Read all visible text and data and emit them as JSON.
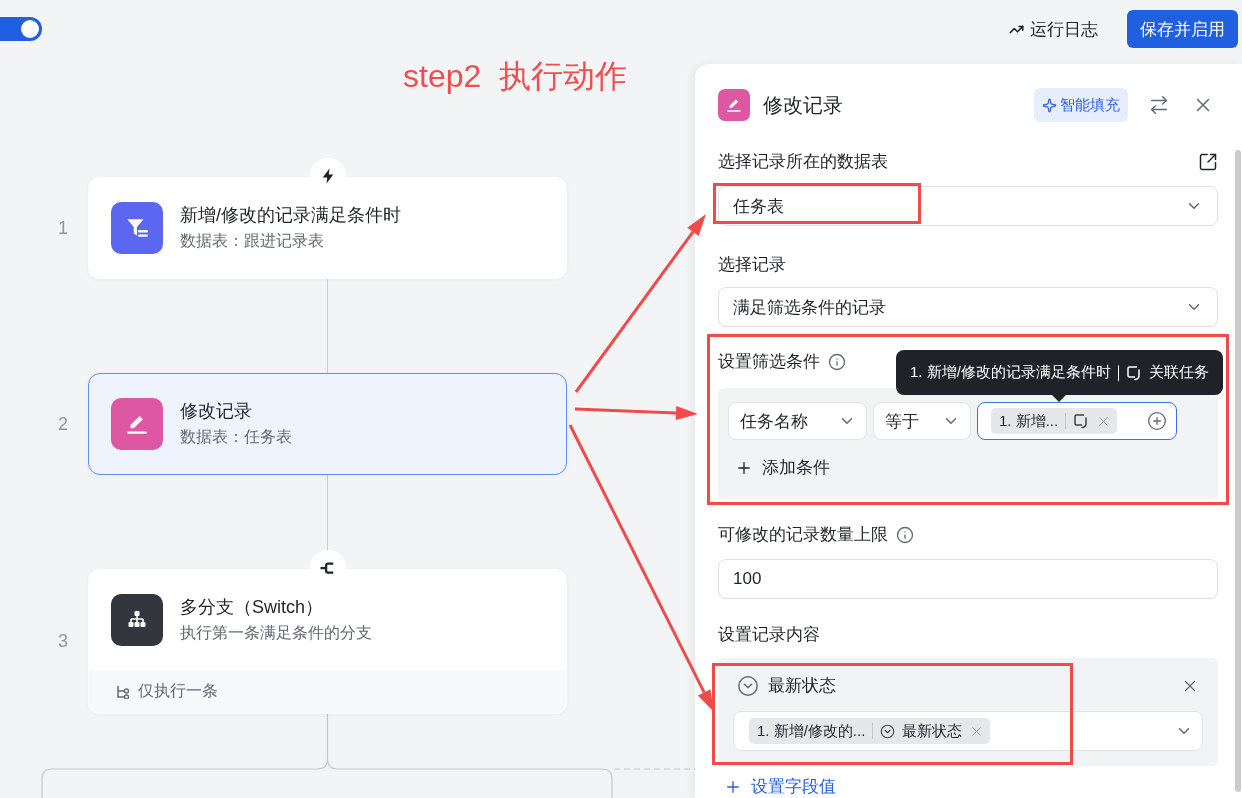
{
  "top_bar": {
    "enable_switch": {
      "on": true
    },
    "run_log": "运行日志",
    "save_button": "保存并启用"
  },
  "annotation": {
    "title": "step2  执行动作"
  },
  "flow": {
    "steps": [
      {
        "number": "1",
        "kind": "trigger",
        "title": "新增/修改的记录满足条件时",
        "subtitle": "数据表：跟进记录表",
        "selected": false
      },
      {
        "number": "2",
        "kind": "action",
        "title": "修改记录",
        "subtitle": "数据表：任务表",
        "selected": true
      },
      {
        "number": "3",
        "kind": "branch",
        "title": "多分支（Switch）",
        "subtitle": "执行第一条满足条件的分支",
        "footer": "仅执行一条",
        "selected": false
      }
    ]
  },
  "panel": {
    "title": "修改记录",
    "smart_fill": "智能填充",
    "table": {
      "label": "选择记录所在的数据表",
      "value": "任务表"
    },
    "record": {
      "label": "选择记录",
      "value": "满足筛选条件的记录"
    },
    "filter": {
      "label": "设置筛选条件",
      "conditions": [
        {
          "field": "任务名称",
          "operator": "等于",
          "value_tag": "1. 新增...",
          "focused": true,
          "tooltip": {
            "source": "1. 新增/修改的记录满足条件时",
            "field": "关联任务"
          }
        }
      ],
      "add_condition": "添加条件"
    },
    "limit": {
      "label": "可修改的记录数量上限",
      "value": "100"
    },
    "content": {
      "label": "设置记录内容",
      "fields": [
        {
          "name": "最新状态",
          "value_source": "1. 新增/修改的...",
          "value_field": "最新状态"
        }
      ],
      "add_field": "设置字段值"
    }
  }
}
